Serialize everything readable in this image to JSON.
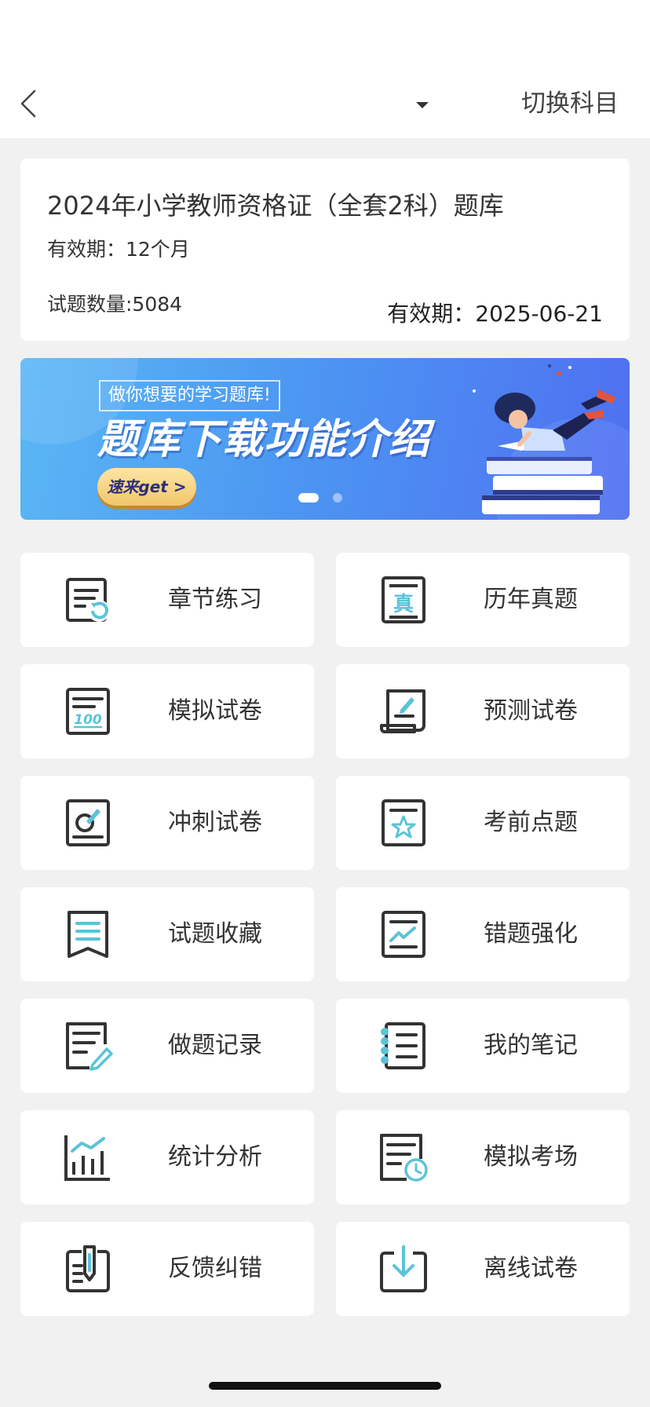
{
  "nav": {
    "switch_label": "切换科目"
  },
  "info": {
    "title": "2024年小学教师资格证（全套2科）题库",
    "validity": "有效期：12个月",
    "question_count": "试题数量:5084",
    "expire": "有效期：2025-06-21"
  },
  "banner": {
    "tag": "做你想要的学习题库!",
    "heading": "题库下载功能介绍",
    "cta": "速来get >",
    "slide_count": 2,
    "active_slide": 1
  },
  "colors": {
    "accent": "#5bc3d8",
    "icon_stroke": "#333333",
    "background": "#f1f1f1"
  },
  "menu": [
    {
      "label": "章节练习",
      "icon": "chapter-practice-icon"
    },
    {
      "label": "历年真题",
      "icon": "past-exams-icon"
    },
    {
      "label": "模拟试卷",
      "icon": "mock-paper-icon"
    },
    {
      "label": "预测试卷",
      "icon": "prediction-paper-icon"
    },
    {
      "label": "冲刺试卷",
      "icon": "sprint-paper-icon"
    },
    {
      "label": "考前点题",
      "icon": "key-points-icon"
    },
    {
      "label": "试题收藏",
      "icon": "favorites-icon"
    },
    {
      "label": "错题强化",
      "icon": "wrong-questions-icon"
    },
    {
      "label": "做题记录",
      "icon": "practice-record-icon"
    },
    {
      "label": "我的笔记",
      "icon": "notes-icon"
    },
    {
      "label": "统计分析",
      "icon": "statistics-icon"
    },
    {
      "label": "模拟考场",
      "icon": "mock-exam-room-icon"
    },
    {
      "label": "反馈纠错",
      "icon": "feedback-icon"
    },
    {
      "label": "离线试卷",
      "icon": "offline-paper-icon"
    }
  ]
}
